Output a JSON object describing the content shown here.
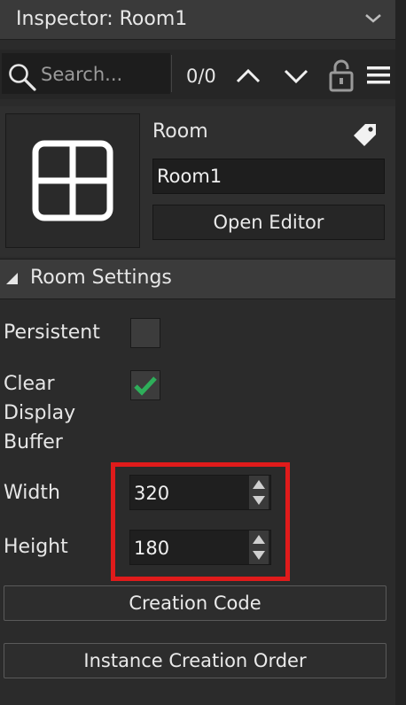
{
  "window": {
    "title": "Inspector: Room1"
  },
  "search": {
    "placeholder": "Search...",
    "match_count": "0/0"
  },
  "asset": {
    "type_label": "Room",
    "name_value": "Room1",
    "open_editor_label": "Open Editor"
  },
  "section": {
    "title": "Room Settings"
  },
  "properties": {
    "persistent": {
      "label": "Persistent",
      "checked": false
    },
    "clear_display_buffer": {
      "label": "Clear Display Buffer",
      "label_lines": [
        "Clear",
        "Display",
        "Buffer"
      ],
      "checked": true
    },
    "width": {
      "label": "Width",
      "value": "320"
    },
    "height": {
      "label": "Height",
      "value": "180"
    }
  },
  "buttons": {
    "creation_code": "Creation Code",
    "instance_creation_order": "Instance Creation Order"
  },
  "colors": {
    "background": "#2b2b2b",
    "highlight": "#e01b1b",
    "check": "#2eae5a"
  },
  "icons": [
    "chevron-down-icon",
    "search-icon",
    "chevron-up-icon",
    "chevron-down-icon",
    "unlock-icon",
    "hamburger-menu-icon",
    "room-grid-icon",
    "tag-icon",
    "triangle-expanded-icon",
    "checkmark-icon",
    "spinner-icon"
  ]
}
